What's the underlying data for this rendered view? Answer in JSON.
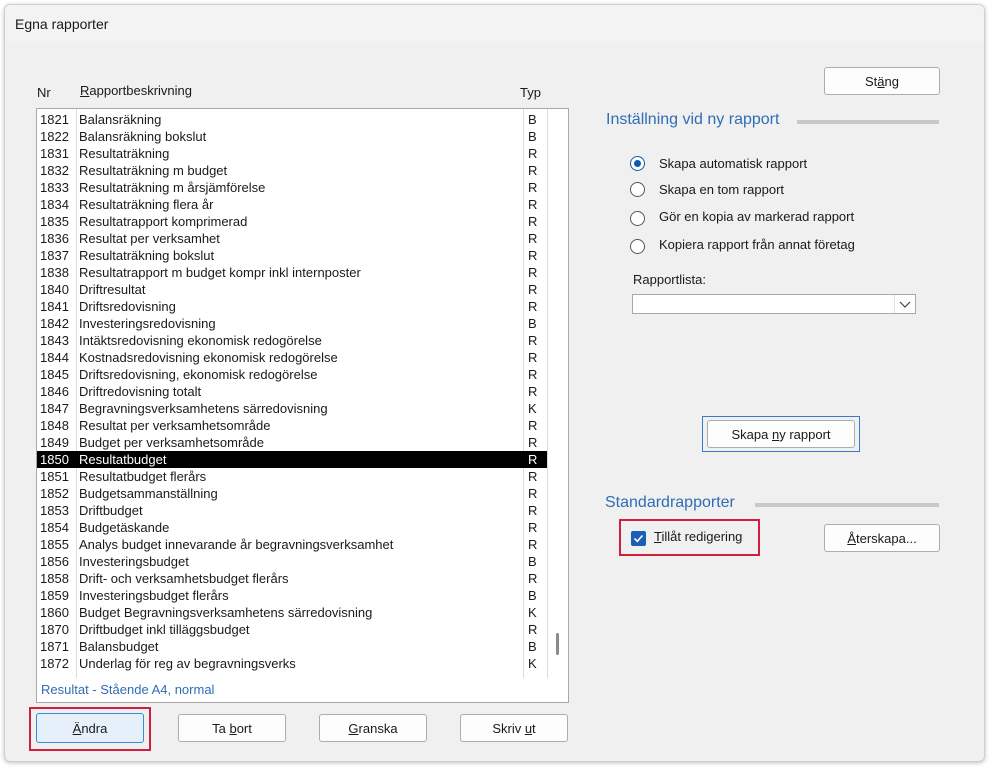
{
  "window": {
    "title": "Egna rapporter"
  },
  "list": {
    "headers": {
      "nr": "Nr",
      "desc": "Rapportbeskrivning",
      "typ": "Typ"
    },
    "rows": [
      {
        "nr": "1821",
        "desc": "Balansräkning",
        "typ": "B"
      },
      {
        "nr": "1822",
        "desc": "Balansräkning bokslut",
        "typ": "B"
      },
      {
        "nr": "1831",
        "desc": "Resultaträkning",
        "typ": "R"
      },
      {
        "nr": "1832",
        "desc": "Resultaträkning m budget",
        "typ": "R"
      },
      {
        "nr": "1833",
        "desc": "Resultaträkning m årsjämförelse",
        "typ": "R"
      },
      {
        "nr": "1834",
        "desc": "Resultaträkning flera år",
        "typ": "R"
      },
      {
        "nr": "1835",
        "desc": "Resultatrapport komprimerad",
        "typ": "R"
      },
      {
        "nr": "1836",
        "desc": "Resultat per verksamhet",
        "typ": "R"
      },
      {
        "nr": "1837",
        "desc": "Resultaträkning bokslut",
        "typ": "R"
      },
      {
        "nr": "1838",
        "desc": "Resultatrapport m budget kompr inkl internposter",
        "typ": "R"
      },
      {
        "nr": "1840",
        "desc": "Driftresultat",
        "typ": "R"
      },
      {
        "nr": "1841",
        "desc": "Driftsredovisning",
        "typ": "R"
      },
      {
        "nr": "1842",
        "desc": "Investeringsredovisning",
        "typ": "B"
      },
      {
        "nr": "1843",
        "desc": "Intäktsredovisning ekonomisk redogörelse",
        "typ": "R"
      },
      {
        "nr": "1844",
        "desc": "Kostnadsredovisning ekonomisk redogörelse",
        "typ": "R"
      },
      {
        "nr": "1845",
        "desc": "Driftsredovisning, ekonomisk redogörelse",
        "typ": "R"
      },
      {
        "nr": "1846",
        "desc": "Driftredovisning totalt",
        "typ": "R"
      },
      {
        "nr": "1847",
        "desc": "Begravningsverksamhetens särredovisning",
        "typ": "K"
      },
      {
        "nr": "1848",
        "desc": "Resultat per verksamhetsområde",
        "typ": "R"
      },
      {
        "nr": "1849",
        "desc": "Budget per verksamhetsområde",
        "typ": "R"
      },
      {
        "nr": "1850",
        "desc": "Resultatbudget",
        "typ": "R"
      },
      {
        "nr": "1851",
        "desc": "Resultatbudget flerårs",
        "typ": "R"
      },
      {
        "nr": "1852",
        "desc": "Budgetsammanställning",
        "typ": "R"
      },
      {
        "nr": "1853",
        "desc": "Driftbudget",
        "typ": "R"
      },
      {
        "nr": "1854",
        "desc": "Budgetäskande",
        "typ": "R"
      },
      {
        "nr": "1855",
        "desc": "Analys budget innevarande år begravningsverksamhet",
        "typ": "R"
      },
      {
        "nr": "1856",
        "desc": "Investeringsbudget",
        "typ": "B"
      },
      {
        "nr": "1858",
        "desc": "Drift- och verksamhetsbudget flerårs",
        "typ": "R"
      },
      {
        "nr": "1859",
        "desc": "Investeringsbudget flerårs",
        "typ": "B"
      },
      {
        "nr": "1860",
        "desc": "Budget Begravningsverksamhetens särredovisning",
        "typ": "K"
      },
      {
        "nr": "1870",
        "desc": "Driftbudget inkl tilläggsbudget",
        "typ": "R"
      },
      {
        "nr": "1871",
        "desc": "Balansbudget",
        "typ": "B"
      },
      {
        "nr": "1872",
        "desc": "Underlag för reg av begravningsverks",
        "typ": "K"
      }
    ],
    "selected_nr": "1850",
    "status": "Resultat  -  Stående A4, normal"
  },
  "bottom_buttons": {
    "andra": "Ändra",
    "ta_bort": "Ta bort",
    "granska": "Granska",
    "skriv_ut": "Skriv ut"
  },
  "close_button": "Stäng",
  "new_report": {
    "title": "Inställning vid ny rapport",
    "options": [
      {
        "label": "Skapa automatisk rapport",
        "selected": true
      },
      {
        "label": "Skapa en tom rapport",
        "selected": false
      },
      {
        "label": "Gör en kopia av markerad rapport",
        "selected": false
      },
      {
        "label": "Kopiera rapport från annat företag",
        "selected": false
      }
    ],
    "list_label": "Rapportlista:",
    "list_value": "",
    "create_button": "Skapa ny rapport"
  },
  "standard": {
    "title": "Standardrapporter",
    "allow_edit_label": "Tillåt redigering",
    "allow_edit_checked": true,
    "restore_button": "Återskapa..."
  },
  "colors": {
    "accent": "#2f6db5",
    "highlight_frame": "#d0203f",
    "selection": "#000000"
  }
}
